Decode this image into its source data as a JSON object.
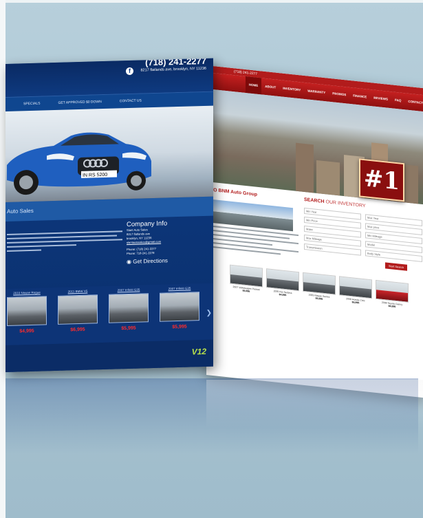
{
  "site_a": {
    "phone": "(718) 241-2277",
    "address": "8217 flatlands ave, brooklyn, NY 11236",
    "nav": [
      "SPECIALS",
      "GET APPROVED $0 DOWN",
      "CONTACT US"
    ],
    "plate": "IN RS 5200",
    "band_title": "Auto Sales",
    "company_info": {
      "title": "Company Info",
      "lines": [
        "Slant Auto Sales",
        "8217 flatlands ave",
        "brooklyn, NY 11236",
        "slantautosales@gmail.com"
      ],
      "phone": "Phone: (718) 241-2277",
      "phone2": "Phone: 718-241-2278",
      "directions": "Get Directions"
    },
    "inventory": [
      {
        "title": "2010 Nissan Rogue",
        "price": "$4,995"
      },
      {
        "title": "2011 BMW X5",
        "price": "$6,995"
      },
      {
        "title": "2007 Infiniti G35",
        "price": "$5,995"
      },
      {
        "title": "2007 Infiniti G35",
        "price": "$5,995"
      }
    ],
    "logo": "V12"
  },
  "site_b": {
    "topbar": "(718) 241-2277",
    "nav": [
      "HOME",
      "ABOUT",
      "INVENTORY",
      "WARRANTY",
      "PROMOS",
      "FINANCE",
      "REVIEWS",
      "FAQ",
      "CONTACT"
    ],
    "badge": "#1",
    "heading": "TO BNM Auto Group",
    "search_title_bold": "SEARCH",
    "search_title_rest": "OUR INVENTORY",
    "fields": [
      "Min Year",
      "Max Year",
      "Min Price",
      "Max price",
      "Make",
      "Min Mileage",
      "Max Mileage",
      "Model",
      "Transmission",
      "Body Style"
    ],
    "search_button": "Start Search",
    "cars": [
      {
        "title": "2007 Volkswagen Passat",
        "price": "$5,995"
      },
      {
        "title": "2005 Kia Sedona",
        "price": "$4,995"
      },
      {
        "title": "2005 Nissan Sentra",
        "price": "$5,995"
      },
      {
        "title": "2008 Honda Civic",
        "price": "$5,995"
      },
      {
        "title": "2008 Toyota Camry",
        "price": "$6,995"
      }
    ]
  }
}
